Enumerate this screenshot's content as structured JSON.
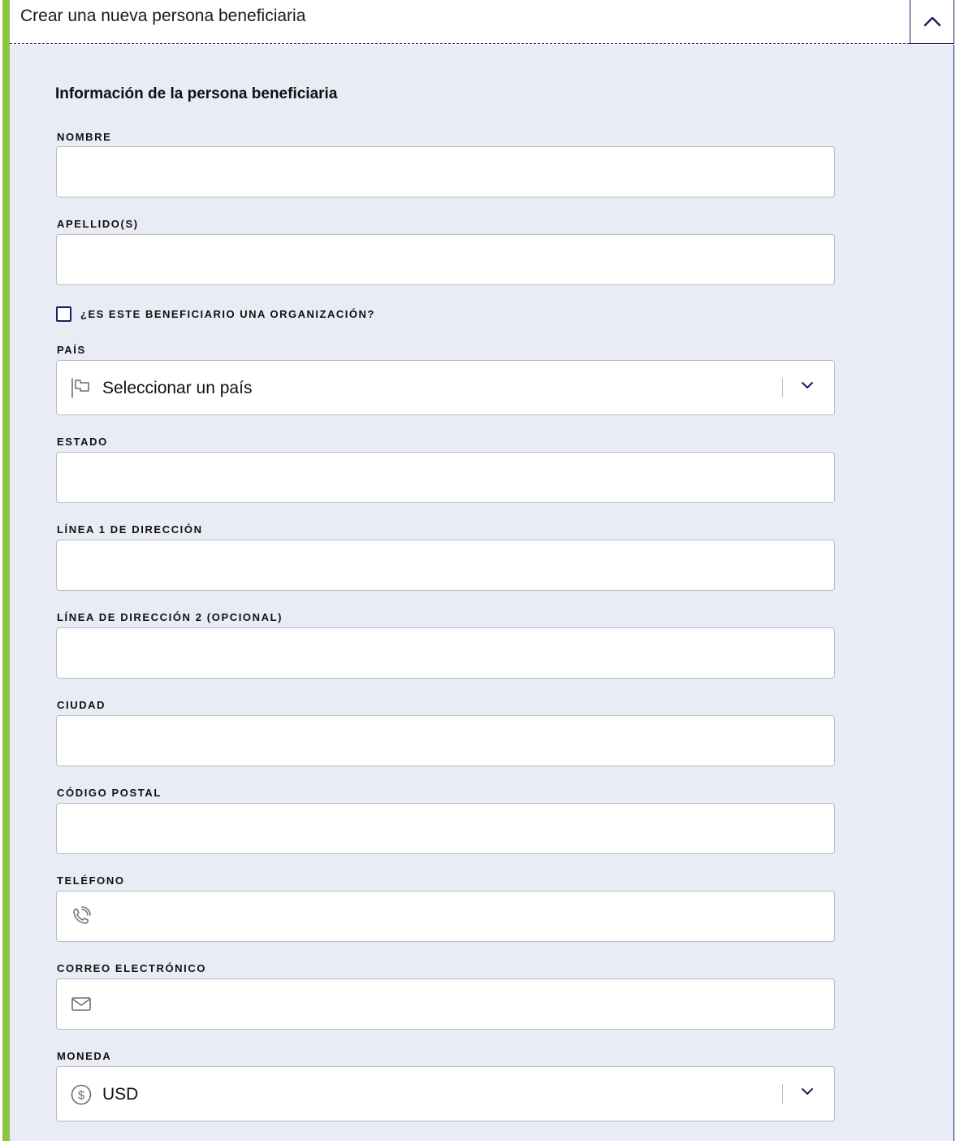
{
  "header": {
    "title": "Crear una nueva persona beneficiaria",
    "collapse_icon": "chevron-up-icon"
  },
  "form": {
    "section_title": "Información de la persona beneficiaria",
    "first_name": {
      "label": "NOMBRE",
      "value": ""
    },
    "last_name": {
      "label": "APELLIDO(S)",
      "value": ""
    },
    "is_organization": {
      "label": "¿ES ESTE BENEFICIARIO UNA ORGANIZACIÓN?",
      "checked": false
    },
    "country": {
      "label": "PAÍS",
      "value": "Seleccionar un país",
      "icon": "flag-icon"
    },
    "state": {
      "label": "ESTADO",
      "value": ""
    },
    "address1": {
      "label": "LÍNEA 1 DE DIRECCIÓN",
      "value": ""
    },
    "address2": {
      "label": "LÍNEA DE DIRECCIÓN 2 (OPCIONAL)",
      "value": ""
    },
    "city": {
      "label": "CIUDAD",
      "value": ""
    },
    "postal_code": {
      "label": "CÓDIGO POSTAL",
      "value": ""
    },
    "phone": {
      "label": "TELÉFONO",
      "value": "",
      "icon": "phone-icon"
    },
    "email": {
      "label": "CORREO ELECTRÓNICO",
      "value": "",
      "icon": "envelope-icon"
    },
    "currency": {
      "label": "MONEDA",
      "value": "USD",
      "icon": "dollar-circle-icon"
    }
  },
  "colors": {
    "accent_green": "#8cc63f",
    "panel_background": "#e9ecf5",
    "navy": "#1a1f5c"
  }
}
